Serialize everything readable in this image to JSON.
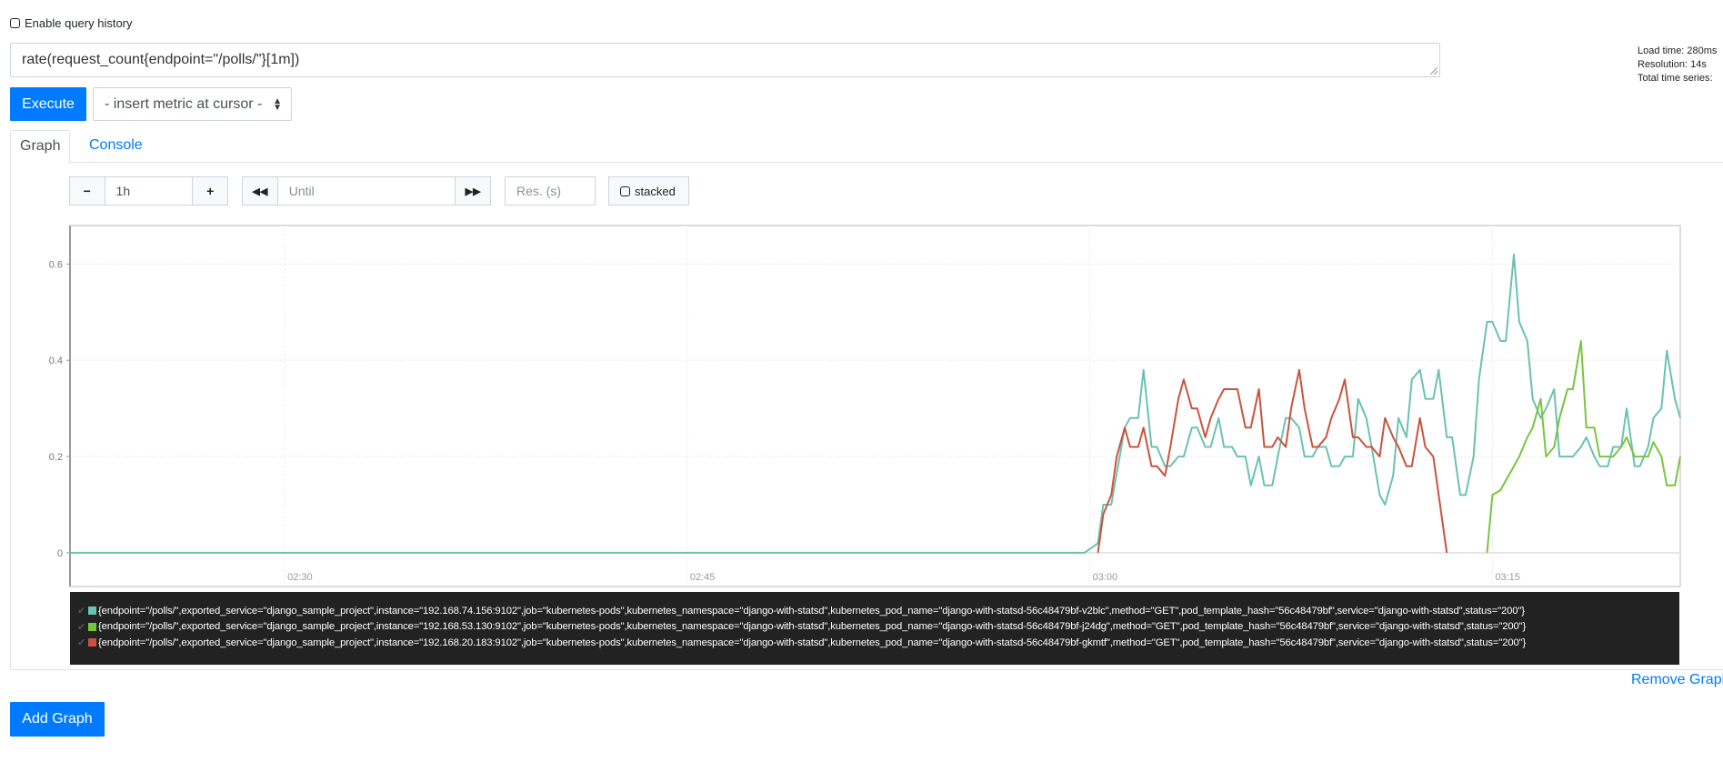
{
  "query_history": {
    "label": "Enable query history",
    "checked": false
  },
  "expression": {
    "value": "rate(request_count{endpoint=\"/polls/\"}[1m])"
  },
  "stats": {
    "load_time": "Load time: 280ms",
    "resolution": "Resolution: 14s",
    "total_series": "Total time series:"
  },
  "toolbar": {
    "execute_label": "Execute",
    "insert_metric_label": "- insert metric at cursor -"
  },
  "tabs": [
    {
      "label": "Graph",
      "active": true
    },
    {
      "label": "Console",
      "active": false
    }
  ],
  "graph_controls": {
    "range_minus": "−",
    "range_value": "1h",
    "range_plus": "+",
    "back_icon": "◀◀",
    "until_placeholder": "Until",
    "forward_icon": "▶▶",
    "res_placeholder": "Res. (s)",
    "stacked_label": "stacked",
    "stacked_checked": false
  },
  "chart_data": {
    "type": "line",
    "title": "",
    "xlabel": "",
    "ylabel": "",
    "x_unit": "minutes after 02:22",
    "xlim": [
      0,
      60
    ],
    "ylim": [
      -0.07,
      0.68
    ],
    "y_ticks": [
      0,
      0.2,
      0.4,
      0.6
    ],
    "y_tick_labels": [
      "0",
      "0.2",
      "0.4",
      "0.6"
    ],
    "x_ticks": [
      8,
      23,
      38,
      53
    ],
    "x_tick_labels": [
      "02:30",
      "02:45",
      "03:00",
      "03:15"
    ],
    "grid": true,
    "legend_position": "bottom",
    "series": [
      {
        "name": "{endpoint=\"/polls/\",exported_service=\"django_sample_project\",instance=\"192.168.74.156:9102\",job=\"kubernetes-pods\",kubernetes_namespace=\"django-with-statsd\",kubernetes_pod_name=\"django-with-statsd-56c48479bf-v2blc\",method=\"GET\",pod_template_hash=\"56c48479bf\",service=\"django-with-statsd\",status=\"200\"}",
        "color": "#6bc1b3",
        "points": [
          [
            0,
            0
          ],
          [
            37.8,
            0
          ],
          [
            38.3,
            0.02
          ],
          [
            38.5,
            0.1
          ],
          [
            38.8,
            0.1
          ],
          [
            39.3,
            0.26
          ],
          [
            39.5,
            0.28
          ],
          [
            39.8,
            0.28
          ],
          [
            40,
            0.38
          ],
          [
            40.3,
            0.22
          ],
          [
            40.5,
            0.22
          ],
          [
            40.8,
            0.18
          ],
          [
            41,
            0.18
          ],
          [
            41.3,
            0.2
          ],
          [
            41.5,
            0.2
          ],
          [
            41.8,
            0.26
          ],
          [
            42,
            0.26
          ],
          [
            42.3,
            0.22
          ],
          [
            42.5,
            0.22
          ],
          [
            42.8,
            0.28
          ],
          [
            43,
            0.22
          ],
          [
            43.3,
            0.22
          ],
          [
            43.5,
            0.2
          ],
          [
            43.8,
            0.2
          ],
          [
            44,
            0.14
          ],
          [
            44.3,
            0.2
          ],
          [
            44.5,
            0.14
          ],
          [
            44.8,
            0.14
          ],
          [
            45,
            0.2
          ],
          [
            45.3,
            0.28
          ],
          [
            45.5,
            0.28
          ],
          [
            45.8,
            0.26
          ],
          [
            46,
            0.2
          ],
          [
            46.3,
            0.2
          ],
          [
            46.5,
            0.22
          ],
          [
            46.8,
            0.22
          ],
          [
            47,
            0.18
          ],
          [
            47.3,
            0.18
          ],
          [
            47.5,
            0.2
          ],
          [
            47.8,
            0.2
          ],
          [
            48,
            0.32
          ],
          [
            48.3,
            0.28
          ],
          [
            48.5,
            0.22
          ],
          [
            48.8,
            0.12
          ],
          [
            49,
            0.1
          ],
          [
            49.3,
            0.16
          ],
          [
            49.5,
            0.28
          ],
          [
            49.8,
            0.24
          ],
          [
            50,
            0.36
          ],
          [
            50.3,
            0.38
          ],
          [
            50.5,
            0.32
          ],
          [
            50.8,
            0.32
          ],
          [
            51,
            0.38
          ],
          [
            51.3,
            0.24
          ],
          [
            51.5,
            0.24
          ],
          [
            51.8,
            0.12
          ],
          [
            52,
            0.12
          ],
          [
            52.3,
            0.2
          ],
          [
            52.5,
            0.36
          ],
          [
            52.8,
            0.48
          ],
          [
            53,
            0.48
          ],
          [
            53.3,
            0.44
          ],
          [
            53.5,
            0.44
          ],
          [
            53.8,
            0.62
          ],
          [
            54,
            0.48
          ],
          [
            54.3,
            0.44
          ],
          [
            54.5,
            0.32
          ],
          [
            54.8,
            0.28
          ],
          [
            55,
            0.3
          ],
          [
            55.3,
            0.34
          ],
          [
            55.5,
            0.2
          ],
          [
            55.8,
            0.2
          ],
          [
            56,
            0.2
          ],
          [
            56.3,
            0.22
          ],
          [
            56.5,
            0.24
          ],
          [
            56.8,
            0.2
          ],
          [
            57,
            0.18
          ],
          [
            57.3,
            0.18
          ],
          [
            57.5,
            0.22
          ],
          [
            57.8,
            0.22
          ],
          [
            58,
            0.3
          ],
          [
            58.3,
            0.18
          ],
          [
            58.5,
            0.18
          ],
          [
            58.8,
            0.22
          ],
          [
            59,
            0.28
          ],
          [
            59.3,
            0.3
          ],
          [
            59.5,
            0.42
          ],
          [
            59.8,
            0.32
          ],
          [
            60,
            0.28
          ]
        ]
      },
      {
        "name": "{endpoint=\"/polls/\",exported_service=\"django_sample_project\",instance=\"192.168.53.130:9102\",job=\"kubernetes-pods\",kubernetes_namespace=\"django-with-statsd\",kubernetes_pod_name=\"django-with-statsd-56c48479bf-j24dg\",method=\"GET\",pod_template_hash=\"56c48479bf\",service=\"django-with-statsd\",status=\"200\"}",
        "color": "#78c53e",
        "points": [
          [
            52.8,
            0
          ],
          [
            53,
            0.12
          ],
          [
            53.3,
            0.13
          ],
          [
            53.5,
            0.15
          ],
          [
            53.8,
            0.18
          ],
          [
            54,
            0.2
          ],
          [
            54.3,
            0.24
          ],
          [
            54.5,
            0.26
          ],
          [
            54.8,
            0.32
          ],
          [
            55,
            0.2
          ],
          [
            55.3,
            0.22
          ],
          [
            55.5,
            0.28
          ],
          [
            55.8,
            0.34
          ],
          [
            56,
            0.34
          ],
          [
            56.3,
            0.44
          ],
          [
            56.5,
            0.26
          ],
          [
            56.8,
            0.26
          ],
          [
            57,
            0.2
          ],
          [
            57.3,
            0.2
          ],
          [
            57.5,
            0.2
          ],
          [
            57.8,
            0.22
          ],
          [
            58,
            0.24
          ],
          [
            58.3,
            0.2
          ],
          [
            58.5,
            0.2
          ],
          [
            58.8,
            0.2
          ],
          [
            59,
            0.23
          ],
          [
            59.3,
            0.2
          ],
          [
            59.5,
            0.14
          ],
          [
            59.8,
            0.14
          ],
          [
            60,
            0.2
          ],
          [
            60.3,
            0.18
          ],
          [
            60.5,
            0.23
          ],
          [
            60.8,
            0.16
          ],
          [
            61,
            0.16
          ],
          [
            61.3,
            0.24
          ]
        ]
      },
      {
        "name": "{endpoint=\"/polls/\",exported_service=\"django_sample_project\",instance=\"192.168.20.183:9102\",job=\"kubernetes-pods\",kubernetes_namespace=\"django-with-statsd\",kubernetes_pod_name=\"django-with-statsd-56c48479bf-gkmtf\",method=\"GET\",pod_template_hash=\"56c48479bf\",service=\"django-with-statsd\",status=\"200\"}",
        "color": "#c9533e",
        "points": [
          [
            38.3,
            0
          ],
          [
            38.5,
            0.08
          ],
          [
            38.8,
            0.12
          ],
          [
            39,
            0.2
          ],
          [
            39.3,
            0.26
          ],
          [
            39.5,
            0.22
          ],
          [
            39.8,
            0.22
          ],
          [
            40,
            0.26
          ],
          [
            40.3,
            0.18
          ],
          [
            40.5,
            0.18
          ],
          [
            40.8,
            0.16
          ],
          [
            41,
            0.22
          ],
          [
            41.3,
            0.32
          ],
          [
            41.5,
            0.36
          ],
          [
            41.8,
            0.3
          ],
          [
            42,
            0.3
          ],
          [
            42.3,
            0.24
          ],
          [
            42.5,
            0.28
          ],
          [
            42.8,
            0.32
          ],
          [
            43,
            0.34
          ],
          [
            43.3,
            0.34
          ],
          [
            43.5,
            0.34
          ],
          [
            43.8,
            0.26
          ],
          [
            44,
            0.26
          ],
          [
            44.3,
            0.34
          ],
          [
            44.5,
            0.22
          ],
          [
            44.8,
            0.22
          ],
          [
            45,
            0.24
          ],
          [
            45.3,
            0.22
          ],
          [
            45.5,
            0.3
          ],
          [
            45.8,
            0.38
          ],
          [
            46,
            0.3
          ],
          [
            46.3,
            0.22
          ],
          [
            46.5,
            0.22
          ],
          [
            46.8,
            0.24
          ],
          [
            47,
            0.28
          ],
          [
            47.3,
            0.32
          ],
          [
            47.5,
            0.36
          ],
          [
            47.8,
            0.24
          ],
          [
            48,
            0.24
          ],
          [
            48.3,
            0.22
          ],
          [
            48.5,
            0.22
          ],
          [
            48.8,
            0.2
          ],
          [
            49,
            0.28
          ],
          [
            49.3,
            0.24
          ],
          [
            49.5,
            0.22
          ],
          [
            49.8,
            0.18
          ],
          [
            50,
            0.18
          ],
          [
            50.3,
            0.28
          ],
          [
            50.5,
            0.22
          ],
          [
            50.8,
            0.2
          ],
          [
            51.3,
            0
          ]
        ]
      }
    ]
  },
  "legend": {
    "check_icon": "✔",
    "items": [
      {
        "label": "{endpoint=\"/polls/\",exported_service=\"django_sample_project\",instance=\"192.168.74.156:9102\",job=\"kubernetes-pods\",kubernetes_namespace=\"django-with-statsd\",kubernetes_pod_name=\"django-with-statsd-56c48479bf-v2blc\",method=\"GET\",pod_template_hash=\"56c48479bf\",service=\"django-with-statsd\",status=\"200\"}",
        "color": "#6bc1b3"
      },
      {
        "label": "{endpoint=\"/polls/\",exported_service=\"django_sample_project\",instance=\"192.168.53.130:9102\",job=\"kubernetes-pods\",kubernetes_namespace=\"django-with-statsd\",kubernetes_pod_name=\"django-with-statsd-56c48479bf-j24dg\",method=\"GET\",pod_template_hash=\"56c48479bf\",service=\"django-with-statsd\",status=\"200\"}",
        "color": "#78c53e"
      },
      {
        "label": "{endpoint=\"/polls/\",exported_service=\"django_sample_project\",instance=\"192.168.20.183:9102\",job=\"kubernetes-pods\",kubernetes_namespace=\"django-with-statsd\",kubernetes_pod_name=\"django-with-statsd-56c48479bf-gkmtf\",method=\"GET\",pod_template_hash=\"56c48479bf\",service=\"django-with-statsd\",status=\"200\"}",
        "color": "#c9533e"
      }
    ]
  },
  "footer": {
    "remove_graph_label": "Remove Graph",
    "add_graph_label": "Add Graph"
  }
}
